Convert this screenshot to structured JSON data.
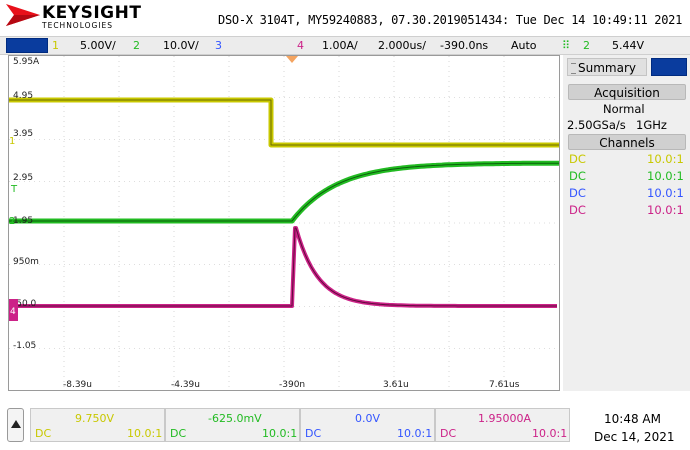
{
  "header": {
    "brand": "KEYSIGHT",
    "brand_sub": "TECHNOLOGIES",
    "info_line": "DSO-X 3104T, MY59240883, 07.30.2019051434: Tue Dec 14 10:49:11 2021"
  },
  "status": {
    "ch1_num": "1",
    "ch1_scale": "5.00V/",
    "ch2_num": "2",
    "ch2_scale": "10.0V/",
    "ch3_num": "3",
    "ch4_num": "4",
    "ch4_scale": "1.00A/",
    "timebase": "2.000us/",
    "delay": "-390.0ns",
    "trigger_mode": "Auto",
    "trigger_ch": "2",
    "trigger_level": "5.44V"
  },
  "screen": {
    "y_labels": [
      "5.95A",
      "4.95",
      "3.95",
      "2.95",
      "1.95",
      "950m",
      "-50.0",
      "-1.05"
    ],
    "x_labels": [
      "-8.39u",
      "-4.39u",
      "-390n",
      "3.61u",
      "7.61us"
    ]
  },
  "panel": {
    "summary_tab": "Summary",
    "acquisition_head": "Acquisition",
    "acq_mode": "Normal",
    "sample_rate": "2.50GSa/s",
    "bandwidth": "1GHz",
    "channels_head": "Channels",
    "channels": [
      {
        "coupling": "DC",
        "probe": "10.0:1"
      },
      {
        "coupling": "DC",
        "probe": "10.0:1"
      },
      {
        "coupling": "DC",
        "probe": "10.0:1"
      },
      {
        "coupling": "DC",
        "probe": "10.0:1"
      }
    ]
  },
  "bottom": {
    "channels": [
      {
        "offset": "9.750V",
        "coupling": "DC",
        "probe": "10.0:1"
      },
      {
        "offset": "-625.0mV",
        "coupling": "DC",
        "probe": "10.0:1"
      },
      {
        "offset": "0.0V",
        "coupling": "DC",
        "probe": "10.0:1"
      },
      {
        "offset": "1.95000A",
        "coupling": "DC",
        "probe": "10.0:1"
      }
    ],
    "clock_time": "10:48 AM",
    "clock_date": "Dec 14, 2021"
  },
  "colors": {
    "ch1": "#c8c800",
    "ch2": "#22bb22",
    "ch3": "#3355ff",
    "ch4": "#cc2288",
    "accent_blue": "#0a3c9e"
  }
}
